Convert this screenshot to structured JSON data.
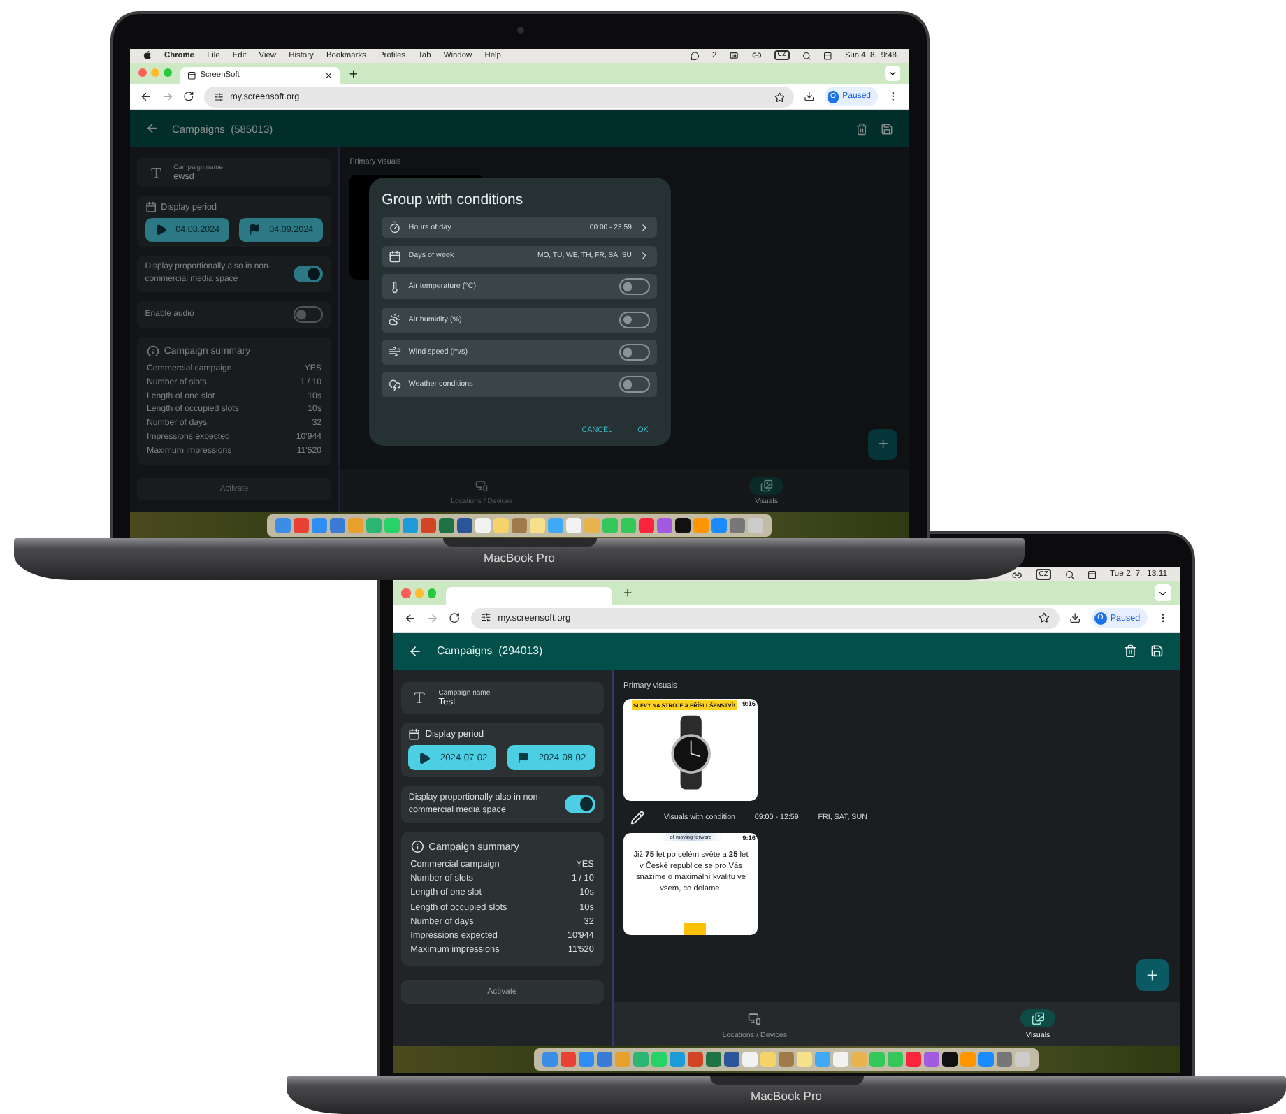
{
  "laptops": [
    {
      "menu_bar": {
        "app": "Chrome",
        "menus": [
          "File",
          "Edit",
          "View",
          "History",
          "Bookmarks",
          "Profiles",
          "Tab",
          "Window",
          "Help"
        ],
        "chat_count": "2",
        "input_source": "CZ",
        "clock": "Sun 4. 8.  9:48"
      },
      "browser": {
        "tab_title": "ScreenSoft",
        "url": "my.screensoft.org",
        "profile_initial": "O",
        "profile_status": "Paused"
      },
      "app": {
        "title": "Campaigns",
        "campaign_id": "(585013)",
        "name_label": "Campaign name",
        "name_value": "ewsd",
        "period_label": "Display period",
        "start_date": "04.08.2024",
        "end_date": "04.09.2024",
        "toggles": [
          {
            "label": "Display proportionally also in non-commercial media space",
            "on": true
          },
          {
            "label": "Enable audio",
            "on": false
          }
        ],
        "summary_title": "Campaign summary",
        "summary": [
          {
            "label": "Commercial campaign",
            "value": "YES"
          },
          {
            "label": "Number of slots",
            "value": "1 / 10"
          },
          {
            "label": "Length of one slot",
            "value": "10s"
          },
          {
            "label": "Length of occupied slots",
            "value": "10s"
          },
          {
            "label": "Number of days",
            "value": "32"
          },
          {
            "label": "Impressions expected",
            "value": "10'944"
          },
          {
            "label": "Maximum impressions",
            "value": "11'520"
          }
        ],
        "activate": {
          "label": "Activate",
          "disabled": true
        },
        "visuals_title": "Primary visuals",
        "visuals": [
          {
            "kind": "blank"
          }
        ],
        "bottom_nav": [
          {
            "label": "Locations / Devices",
            "selected": false
          },
          {
            "label": "Visuals",
            "selected": true
          }
        ],
        "dialog": {
          "title": "Group with conditions",
          "rows": [
            {
              "kind": "link",
              "label": "Hours of day",
              "value": "00:00 - 23:59"
            },
            {
              "kind": "link",
              "label": "Days of week",
              "value": "MO, TU, WE, TH, FR, SA, SU"
            },
            {
              "kind": "switch",
              "label": "Air temperature (°C)",
              "on": false
            },
            {
              "kind": "switch",
              "label": "Air humidity (%)",
              "on": false
            },
            {
              "kind": "switch",
              "label": "Wind speed (m/s)",
              "on": false
            },
            {
              "kind": "switch",
              "label": "Weather conditions",
              "on": false
            }
          ],
          "buttons": [
            "CANCEL",
            "OK"
          ]
        }
      },
      "device_label": "MacBook Pro"
    },
    {
      "menu_bar": {
        "input_source": "CZ",
        "clock": "Tue 2. 7.  13:11"
      },
      "browser": {
        "url": "my.screensoft.org",
        "profile_initial": "O",
        "profile_status": "Paused"
      },
      "app": {
        "title": "Campaigns",
        "campaign_id": "(294013)",
        "name_label": "Campaign name",
        "name_value": "Test",
        "period_label": "Display period",
        "start_date": "2024-07-02",
        "end_date": "2024-08-02",
        "toggles": [
          {
            "label": "Display proportionally also in non-commercial media space",
            "on": true
          }
        ],
        "summary_title": "Campaign summary",
        "summary": [
          {
            "label": "Commercial campaign",
            "value": "YES"
          },
          {
            "label": "Number of slots",
            "value": "1 / 10"
          },
          {
            "label": "Length of one slot",
            "value": "10s"
          },
          {
            "label": "Length of occupied slots",
            "value": "10s"
          },
          {
            "label": "Number of days",
            "value": "32"
          },
          {
            "label": "Impressions expected",
            "value": "10'944"
          },
          {
            "label": "Maximum impressions",
            "value": "11'520"
          }
        ],
        "activate": {
          "label": "Activate",
          "disabled": true
        },
        "visuals_title": "Primary visuals",
        "visuals": [
          {
            "kind": "image",
            "badge": "9:16",
            "banner": "SLEVY NA STROJE A PŘÍSLUŠENSTVÍ!"
          },
          {
            "kind": "condition",
            "label": "Visuals with condition",
            "time": "09:00 - 12:59",
            "days": "FRI, SAT, SUN"
          },
          {
            "kind": "text",
            "badge": "9:16",
            "header": "of moving forward",
            "body": "Již **75** let  po celém světe a **25** let v České republice se pro Vás snažíme o maximální kvalitu ve všem, co děláme."
          }
        ],
        "bottom_nav": [
          {
            "label": "Locations / Devices",
            "selected": false
          },
          {
            "label": "Visuals",
            "selected": true
          }
        ]
      },
      "device_label": "MacBook Pro"
    }
  ]
}
